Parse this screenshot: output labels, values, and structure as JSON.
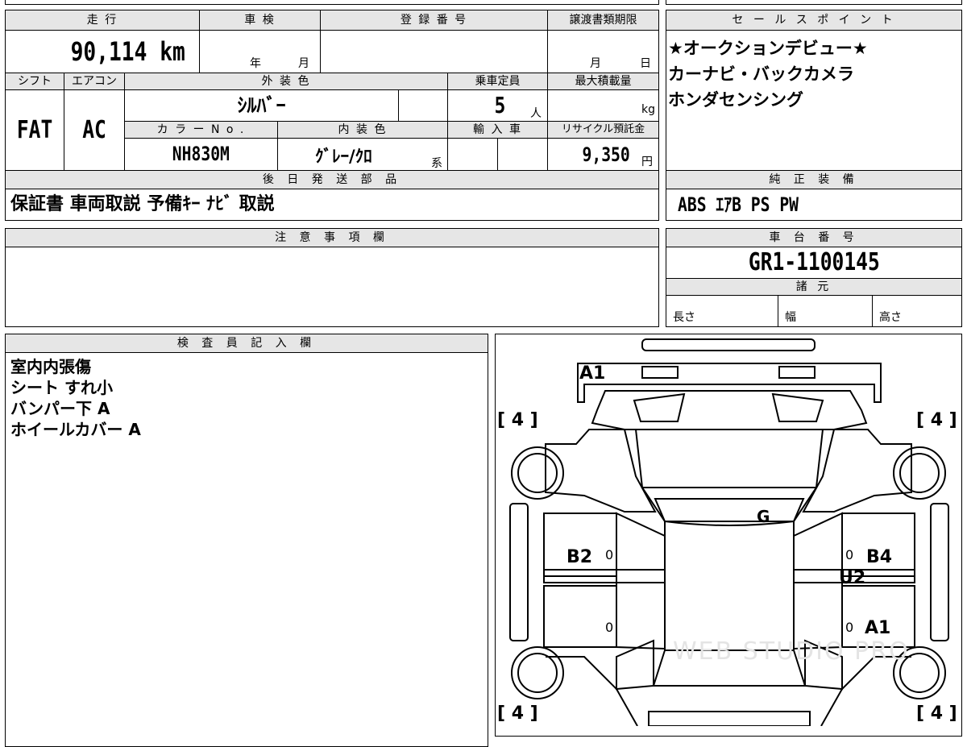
{
  "top_table": {
    "headers": {
      "mileage": "走 行",
      "inspection": "車 検",
      "registration": "登 録 番 号",
      "transfer_deadline": "譲渡書類期限",
      "shift": "シフト",
      "aircon": "エアコン",
      "exterior_color": "外 装 色",
      "capacity": "乗車定員",
      "max_load": "最大積載量",
      "color_no": "カ ラ ー N o .",
      "interior_color": "内 装 色",
      "import": "輸 入 車",
      "recycle_fee": "リサイクル預託金",
      "later_parts": "後 日 発 送 部 品"
    },
    "values": {
      "mileage": "90,114 km",
      "inspection_year_unit": "年",
      "inspection_month_unit": "月",
      "transfer_month_unit": "月",
      "transfer_day_unit": "日",
      "shift": "FAT",
      "aircon": "AC",
      "exterior_color": "ｼﾙﾊﾞｰ",
      "capacity": "5",
      "capacity_unit": "人",
      "max_load_unit": "kg",
      "color_no": "NH830M",
      "interior_color": "ｸﾞﾚｰ/ｸﾛ",
      "interior_suffix": "系",
      "recycle_fee": "9,350",
      "recycle_unit": "円",
      "later_parts": "保証書 車両取説 予備ｷｰ ﾅﾋﾞ 取説"
    }
  },
  "sales_points": {
    "header": "セ ー ル ス ポ イ ン ト",
    "lines": [
      "★オークションデビュー★",
      "カーナビ・バックカメラ",
      "ホンダセンシング"
    ]
  },
  "equipment": {
    "header": "純 正 装 備",
    "value": "ABS ｴｱB PS PW"
  },
  "notes": {
    "header": "注 意 事 項 欄"
  },
  "chassis": {
    "header": "車 台 番 号",
    "value": "GR1-1100145",
    "specs_header": "諸 元",
    "length": "長さ",
    "width": "幅",
    "height": "高さ"
  },
  "inspector": {
    "header": "検 査 員 記 入 欄",
    "lines": [
      "室内内張傷",
      "シート すれ小",
      "バンパー下 A",
      "ホイールカバー A"
    ]
  },
  "diagram": {
    "tire_front_left": "[ 4 ]",
    "tire_front_right": "[ 4 ]",
    "tire_rear_left": "[ 4 ]",
    "tire_rear_right": "[ 4 ]",
    "mark_front": "A1",
    "mark_glass": "G",
    "mark_left_door": "B2",
    "mark_right_door": "B4",
    "mark_right_door_under": "U2",
    "mark_right_rear": "A1",
    "zero_1": "0",
    "zero_2": "0",
    "zero_3": "0",
    "zero_4": "0",
    "watermark": "WEB STUDIO PRO"
  }
}
